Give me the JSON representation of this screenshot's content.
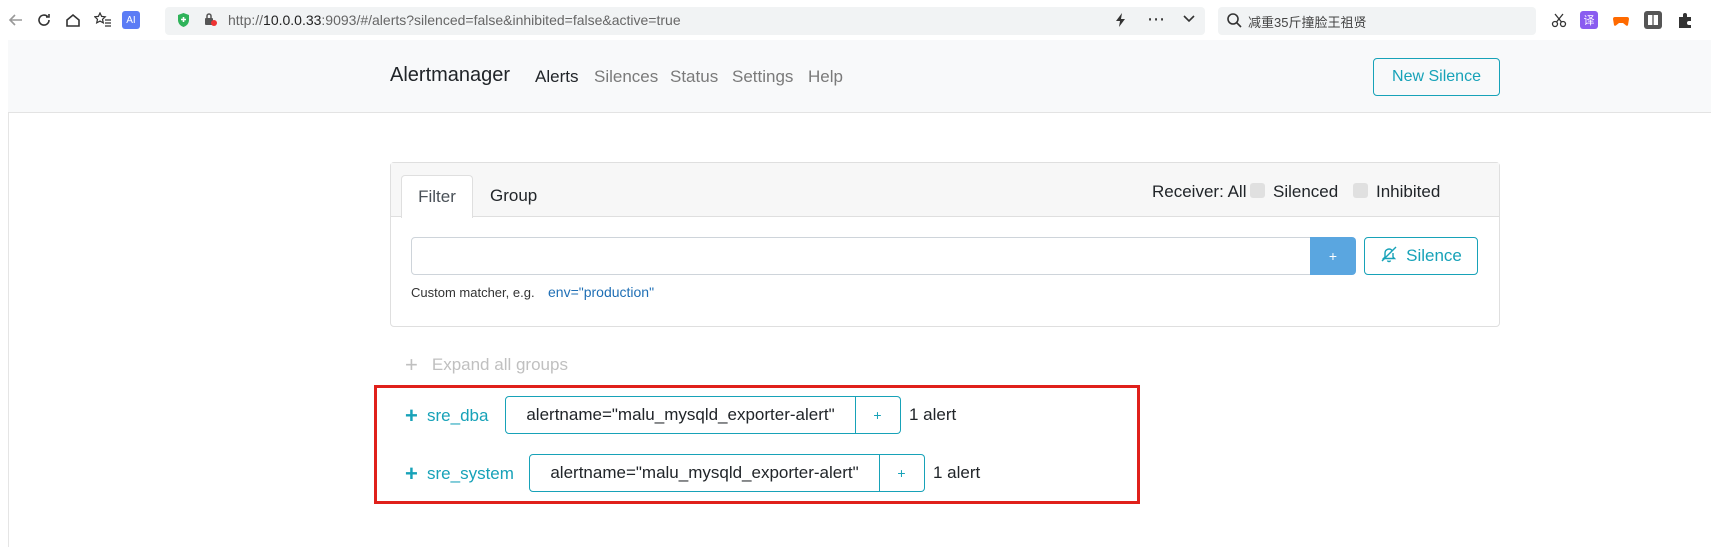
{
  "browser": {
    "url_prefix": "http://",
    "url_host": "10.0.0.33",
    "url_rest": ":9093/#/alerts?silenced=false&inhibited=false&active=true",
    "search_text": "减重35斤撞脸王祖贤",
    "ai_badge": "AI",
    "translate_badge": "译"
  },
  "navbar": {
    "brand": "Alertmanager",
    "links": [
      "Alerts",
      "Silences",
      "Status",
      "Settings",
      "Help"
    ],
    "new_silence": "New Silence"
  },
  "filter_card": {
    "tabs": [
      "Filter",
      "Group"
    ],
    "receiver": "Receiver: All",
    "silenced_label": "Silenced",
    "inhibited_label": "Inhibited",
    "input_value": "",
    "add_button": "+",
    "silence_button": "Silence",
    "hint": "Custom matcher, e.g.",
    "hint_example": "env=\"production\""
  },
  "groups": {
    "expand_all": "Expand all groups",
    "items": [
      {
        "plus": "+",
        "name": "sre_dba",
        "label": "alertname=\"malu_mysqld_exporter-alert\"",
        "label_add": "+",
        "count": "1 alert"
      },
      {
        "plus": "+",
        "name": "sre_system",
        "label": "alertname=\"malu_mysqld_exporter-alert\"",
        "label_add": "+",
        "count": "1 alert"
      }
    ]
  },
  "colors": {
    "accent": "#17a2b8",
    "primary_button": "#5aa6e0",
    "highlight": "#e0201b"
  }
}
